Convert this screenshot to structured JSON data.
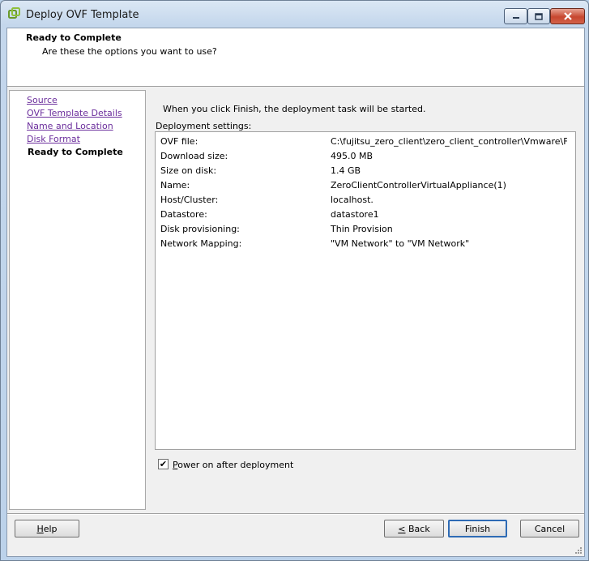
{
  "window": {
    "title": "Deploy OVF Template"
  },
  "header": {
    "title": "Ready to Complete",
    "subtitle": "Are these the options you want to use?"
  },
  "nav": {
    "links": [
      {
        "label": "Source"
      },
      {
        "label": "OVF Template Details"
      },
      {
        "label": "Name and Location"
      },
      {
        "label": "Disk Format"
      }
    ],
    "current": "Ready to Complete"
  },
  "main": {
    "intro": "When you click Finish, the deployment task will be started.",
    "settings_label": "Deployment settings:",
    "settings": [
      {
        "key": "OVF file:",
        "value": "C:\\fujitsu_zero_client\\zero_client_controller\\Vmware\\FTS..."
      },
      {
        "key": "Download size:",
        "value": "495.0 MB"
      },
      {
        "key": "Size on disk:",
        "value": "1.4 GB"
      },
      {
        "key": "Name:",
        "value": "ZeroClientControllerVirtualAppliance(1)"
      },
      {
        "key": "Host/Cluster:",
        "value": "localhost."
      },
      {
        "key": "Datastore:",
        "value": "datastore1"
      },
      {
        "key": "Disk provisioning:",
        "value": "Thin Provision"
      },
      {
        "key": "Network Mapping:",
        "value": "\"VM Network\" to \"VM Network\""
      }
    ],
    "power_on": {
      "label_mnemonic": "P",
      "label_rest": "ower on after deployment",
      "checked": true,
      "mark": "✔"
    }
  },
  "buttons": {
    "help_mnemonic": "H",
    "help_rest": "elp",
    "back_mnemonic": "<",
    "back_rest": " Back",
    "finish": "Finish",
    "cancel": "Cancel"
  },
  "icons": {
    "app": "vmware-ovf-icon",
    "minimize": "minimize-icon",
    "maximize": "maximize-icon",
    "close": "close-icon",
    "check": "checkmark-icon",
    "grip": "resize-grip-icon"
  },
  "colors": {
    "link": "#6b2e9c",
    "accent": "#2e6bb5",
    "close": "#c7472f"
  }
}
